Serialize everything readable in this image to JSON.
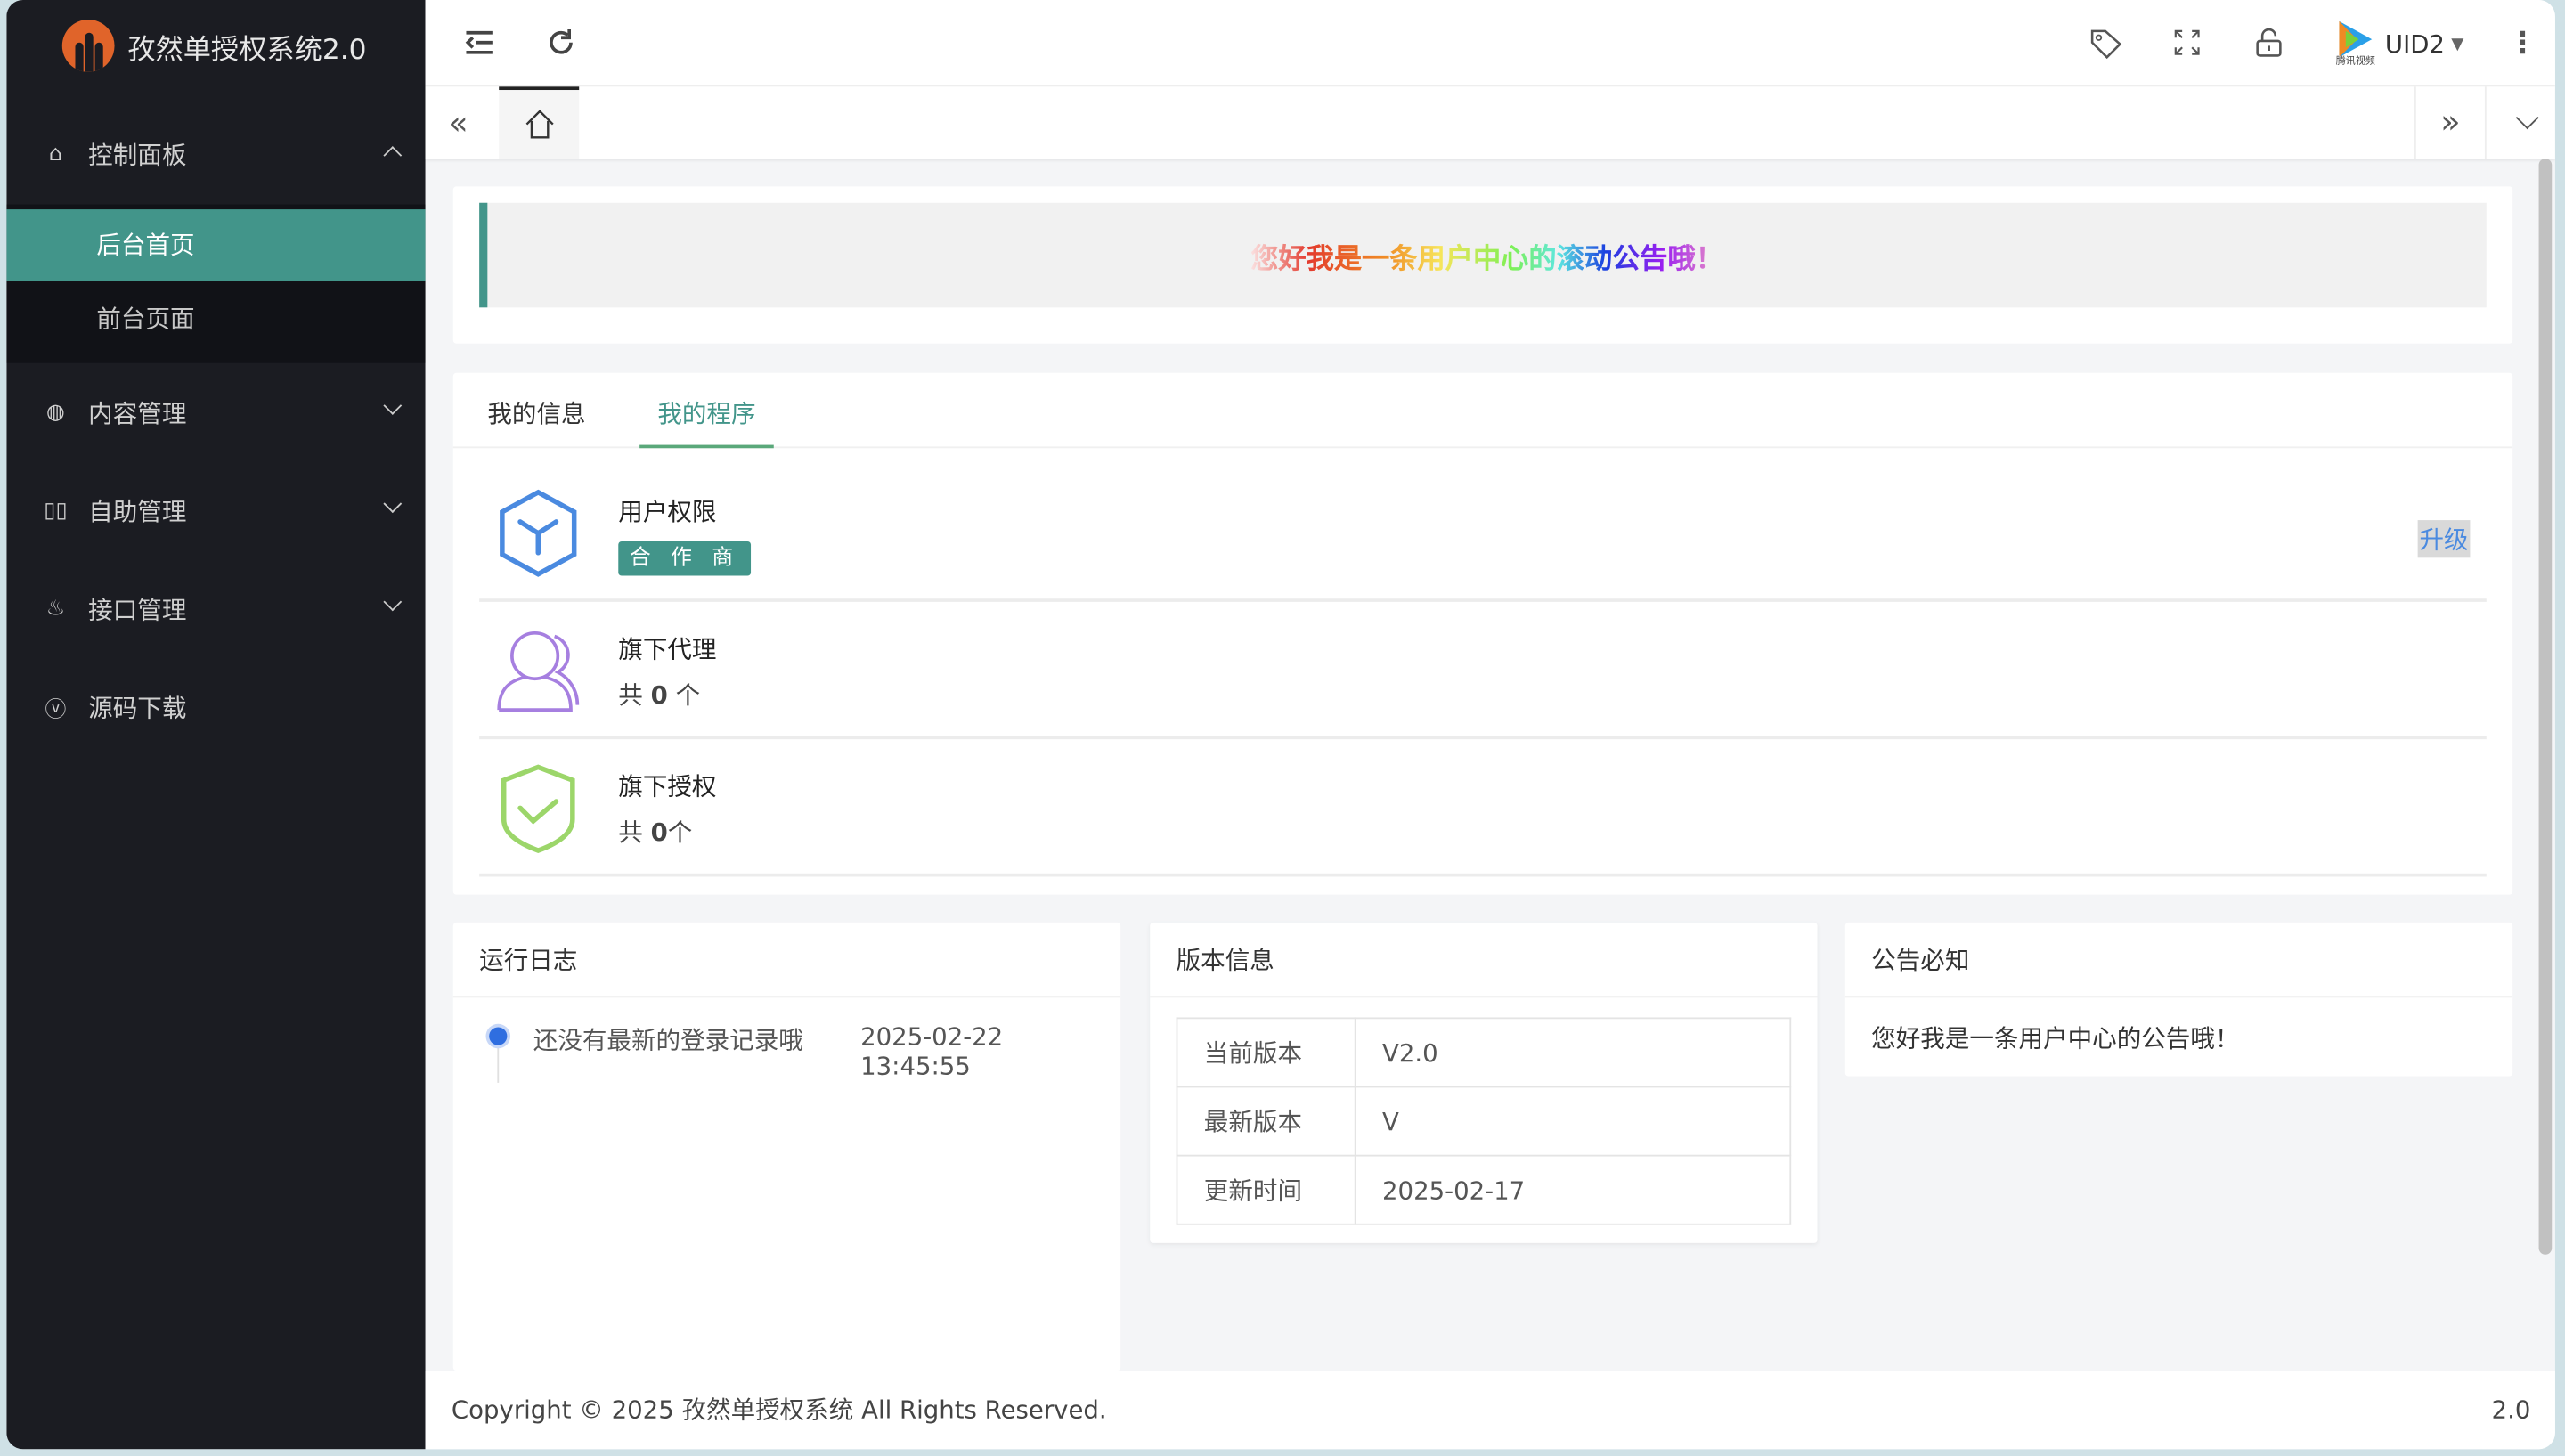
{
  "app": {
    "title": "孜然单授权系统2.0"
  },
  "sidebar": {
    "items": [
      {
        "label": "控制面板",
        "icon": "home-icon",
        "expanded": true,
        "children": [
          {
            "label": "后台首页",
            "active": true
          },
          {
            "label": "前台页面"
          }
        ]
      },
      {
        "label": "内容管理",
        "icon": "globe-icon"
      },
      {
        "label": "自助管理",
        "icon": "toggle-icon"
      },
      {
        "label": "接口管理",
        "icon": "fire-icon"
      },
      {
        "label": "源码下载",
        "icon": "download-icon"
      }
    ]
  },
  "header": {
    "user": "UID2",
    "avatar_caption": "腾讯视频"
  },
  "notice": {
    "text": "您好我是一条用户中心的滚动公告哦！"
  },
  "program_tabs": [
    {
      "label": "我的信息"
    },
    {
      "label": "我的程序",
      "active": true
    }
  ],
  "program": {
    "rows": [
      {
        "title": "用户权限",
        "badge": "合 作 商",
        "action": "升级"
      },
      {
        "title": "旗下代理",
        "prefix": "共",
        "count": "0",
        "suffix": "个"
      },
      {
        "title": "旗下授权",
        "prefix": "共",
        "count": "0",
        "suffix": "个"
      }
    ]
  },
  "log": {
    "title": "运行日志",
    "entries": [
      {
        "text": "还没有最新的登录记录哦",
        "time": "2025-02-22 13:45:55"
      }
    ]
  },
  "version": {
    "title": "版本信息",
    "rows": [
      {
        "k": "当前版本",
        "v": "V2.0"
      },
      {
        "k": "最新版本",
        "v": "V"
      },
      {
        "k": "更新时间",
        "v": "2025-02-17"
      }
    ]
  },
  "announce": {
    "title": "公告必知",
    "text": "您好我是一条用户中心的公告哦！"
  },
  "footer": {
    "copyright": "Copyright © 2025 孜然单授权系统 All Rights Reserved.",
    "version": "2.0"
  },
  "colors": {
    "accent": "#42958a",
    "sidebar": "#1b1c22",
    "link": "#4a8ae0"
  }
}
